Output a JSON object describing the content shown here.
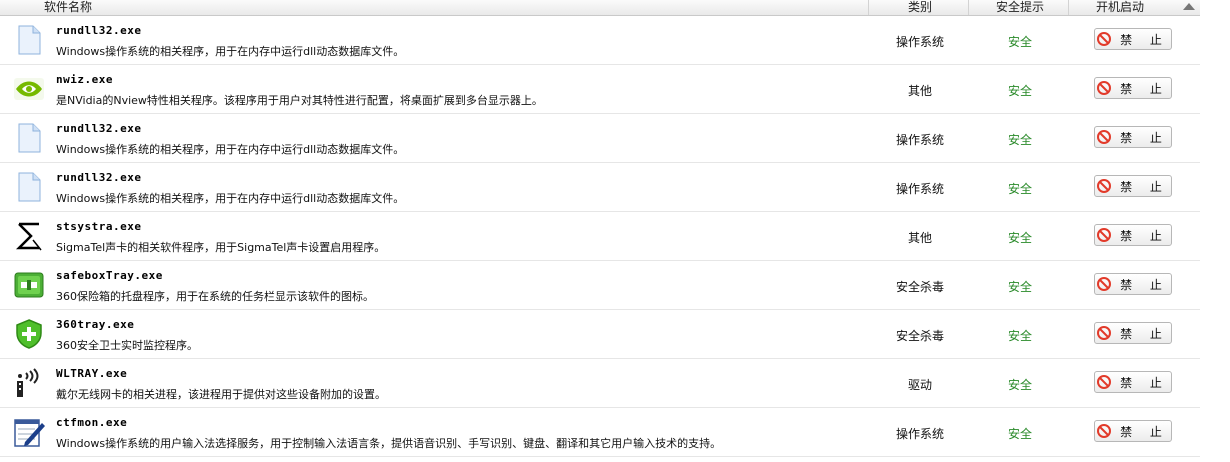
{
  "header": {
    "col_name": "软件名称",
    "col_category": "类别",
    "col_safety": "安全提示",
    "col_startup": "开机启动"
  },
  "rows": [
    {
      "icon": "document-icon",
      "name": "rundll32.exe",
      "desc": "Windows操作系统的相关程序，用于在内存中运行dll动态数据库文件。",
      "category": "操作系统",
      "safety": "安全",
      "action": "禁 止"
    },
    {
      "icon": "nvidia-eye-icon",
      "name": "nwiz.exe",
      "desc": "是NVidia的Nview特性相关程序。该程序用于用户对其特性进行配置，将桌面扩展到多台显示器上。",
      "category": "其他",
      "safety": "安全",
      "action": "禁 止"
    },
    {
      "icon": "document-icon",
      "name": "rundll32.exe",
      "desc": "Windows操作系统的相关程序，用于在内存中运行dll动态数据库文件。",
      "category": "操作系统",
      "safety": "安全",
      "action": "禁 止"
    },
    {
      "icon": "document-icon",
      "name": "rundll32.exe",
      "desc": "Windows操作系统的相关程序，用于在内存中运行dll动态数据库文件。",
      "category": "操作系统",
      "safety": "安全",
      "action": "禁 止"
    },
    {
      "icon": "sigmatel-sigma-icon",
      "name": "stsystra.exe",
      "desc": "SigmaTel声卡的相关软件程序，用于SigmaTel声卡设置启用程序。",
      "category": "其他",
      "safety": "安全",
      "action": "禁 止"
    },
    {
      "icon": "safebox-icon",
      "name": "safeboxTray.exe",
      "desc": "360保险箱的托盘程序，用于在系统的任务栏显示该软件的图标。",
      "category": "安全杀毒",
      "safety": "安全",
      "action": "禁 止"
    },
    {
      "icon": "shield-icon",
      "name": "360tray.exe",
      "desc": "360安全卫士实时监控程序。",
      "category": "安全杀毒",
      "safety": "安全",
      "action": "禁 止"
    },
    {
      "icon": "wireless-antenna-icon",
      "name": "WLTRAY.exe",
      "desc": "戴尔无线网卡的相关进程，该进程用于提供对这些设备附加的设置。",
      "category": "驱动",
      "safety": "安全",
      "action": "禁 止"
    },
    {
      "icon": "notepad-pen-icon",
      "name": "ctfmon.exe",
      "desc": "Windows操作系统的用户输入法选择服务，用于控制输入法语言条，提供语音识别、手写识别、键盘、翻译和其它用户输入技术的支持。",
      "category": "操作系统",
      "safety": "安全",
      "action": "禁 止"
    }
  ]
}
